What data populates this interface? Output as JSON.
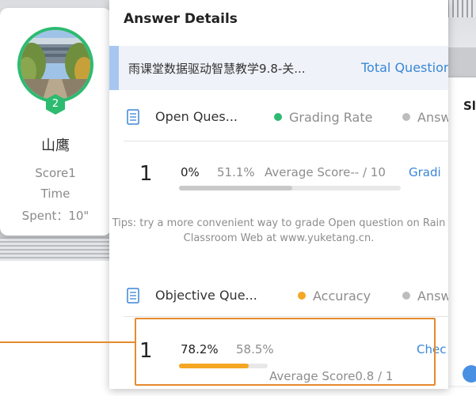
{
  "colors": {
    "accent_green": "#2dbb70",
    "accent_orange": "#e68a2e",
    "link_blue": "#3a86d6"
  },
  "student": {
    "rank": "2",
    "name": "山鹰",
    "score_label": "Score1",
    "time_label": "Time",
    "spent_label": "Spent：10\""
  },
  "panel": {
    "title": "Answer Details",
    "course_name": "雨课堂数据驱动智慧教学9.8-关...",
    "total_questions_link": "Total Questions"
  },
  "open_section": {
    "label": "Open Ques...",
    "legend_primary": "Grading Rate",
    "legend_secondary": "Answ",
    "question": {
      "number": "1",
      "grading_rate": "0%",
      "answer_rate": "51.1%",
      "answer_fraction": 0.511,
      "average_score": "Average Score-- / 10",
      "action_link": "Gradi"
    },
    "tips": "Tips: try a more convenient way to grade Open question on Rain Classroom Web at www.yuketang.cn."
  },
  "objective_section": {
    "label": "Objective Que...",
    "legend_primary": "Accuracy",
    "legend_secondary": "Answ",
    "question": {
      "number": "1",
      "accuracy": "78.2%",
      "accuracy_fraction": 0.782,
      "answer_rate": "58.5%",
      "average_score": "Average Score0.8 / 1",
      "action_link": "Chec"
    }
  },
  "side_panel": {
    "title": "Sl"
  }
}
